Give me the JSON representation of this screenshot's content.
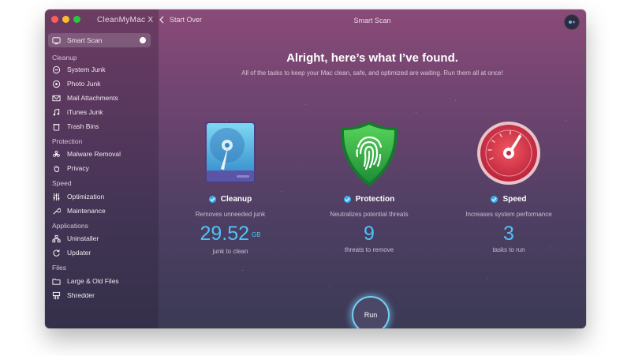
{
  "window": {
    "app_title": "CleanMyMac X",
    "back_label": "Start Over",
    "title": "Smart Scan"
  },
  "sidebar": {
    "active_item": {
      "label": "Smart Scan",
      "icon": "monitor-icon"
    },
    "sections": [
      {
        "label": "Cleanup",
        "items": [
          {
            "label": "System Junk",
            "icon": "system-junk-icon"
          },
          {
            "label": "Photo Junk",
            "icon": "photo-junk-icon"
          },
          {
            "label": "Mail Attachments",
            "icon": "mail-icon"
          },
          {
            "label": "iTunes Junk",
            "icon": "music-note-icon"
          },
          {
            "label": "Trash Bins",
            "icon": "trash-icon"
          }
        ]
      },
      {
        "label": "Protection",
        "items": [
          {
            "label": "Malware Removal",
            "icon": "biohazard-icon"
          },
          {
            "label": "Privacy",
            "icon": "hand-icon"
          }
        ]
      },
      {
        "label": "Speed",
        "items": [
          {
            "label": "Optimization",
            "icon": "sliders-icon"
          },
          {
            "label": "Maintenance",
            "icon": "wrench-icon"
          }
        ]
      },
      {
        "label": "Applications",
        "items": [
          {
            "label": "Uninstaller",
            "icon": "uninstaller-icon"
          },
          {
            "label": "Updater",
            "icon": "updater-icon"
          }
        ]
      },
      {
        "label": "Files",
        "items": [
          {
            "label": "Large & Old Files",
            "icon": "folder-icon"
          },
          {
            "label": "Shredder",
            "icon": "shredder-icon"
          }
        ]
      }
    ]
  },
  "main": {
    "heading": "Alright, here’s what I’ve found.",
    "subheading": "All of the tasks to keep your Mac clean, safe, and optimized are waiting. Run them all at once!",
    "cards": [
      {
        "title": "Cleanup",
        "description": "Removes unneeded junk",
        "value": "29.52",
        "unit": "GB",
        "value_label": "junk to clean",
        "icon": "hard-drive-icon"
      },
      {
        "title": "Protection",
        "description": "Neutralizes potential threats",
        "value": "9",
        "unit": "",
        "value_label": "threats to remove",
        "icon": "shield-fingerprint-icon"
      },
      {
        "title": "Speed",
        "description": "Increases system performance",
        "value": "3",
        "unit": "",
        "value_label": "tasks to run",
        "icon": "speedometer-icon"
      }
    ],
    "run_label": "Run"
  },
  "colors": {
    "accent": "#4fc3f7",
    "window_top": "#8a4a78",
    "window_bottom": "#3b3a55",
    "shield_green": "#2fb344",
    "gauge_red": "#e0384a"
  }
}
